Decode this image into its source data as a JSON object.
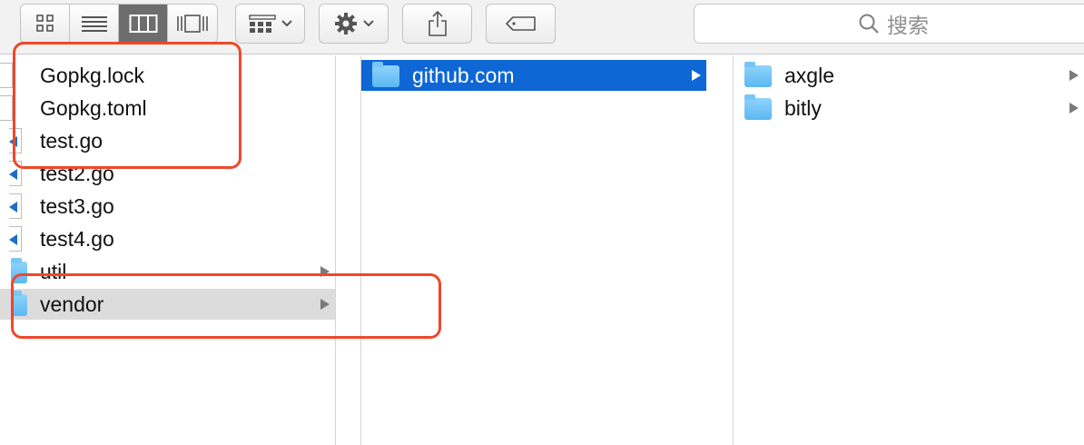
{
  "toolbar": {
    "view_modes": [
      {
        "name": "icon-view",
        "active": false
      },
      {
        "name": "list-view",
        "active": false
      },
      {
        "name": "column-view",
        "active": true
      },
      {
        "name": "cover-flow-view",
        "active": false
      }
    ],
    "arrange_icon": "grid-arrange-icon",
    "action_icon": "gear-icon",
    "share_icon": "share-icon",
    "tag_icon": "tag-icon",
    "search_placeholder": "搜索"
  },
  "columns": {
    "first": [
      {
        "label": "Gopkg.lock",
        "icon": "document-icon"
      },
      {
        "label": "Gopkg.toml",
        "icon": "document-icon"
      },
      {
        "label": "test.go",
        "icon": "go-file-icon"
      },
      {
        "label": "test2.go",
        "icon": "go-file-icon"
      },
      {
        "label": "test3.go",
        "icon": "go-file-icon"
      },
      {
        "label": "test4.go",
        "icon": "go-file-icon"
      },
      {
        "label": "util",
        "icon": "folder-icon"
      },
      {
        "label": "vendor",
        "icon": "folder-icon"
      }
    ],
    "second": [
      {
        "label": "github.com",
        "icon": "folder-icon"
      }
    ],
    "third": [
      {
        "label": "axgle",
        "icon": "folder-icon"
      },
      {
        "label": "bitly",
        "icon": "folder-icon"
      }
    ]
  },
  "colors": {
    "selection": "#0f67d6",
    "path_highlight": "#dcdcdc",
    "annotation": "#f0472a"
  }
}
